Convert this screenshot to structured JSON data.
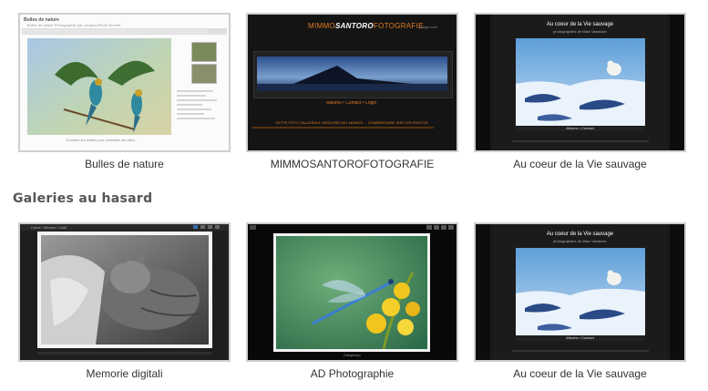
{
  "featured": [
    {
      "caption": "Bulles de nature",
      "site_title": "Bulles de nature",
      "site_subtitle": "Bulles de nature Photographie par Jacques-Pierre Bonnet",
      "photo_caption": "Ecoutez les bulles pour connaitre les ailes... "
    },
    {
      "caption": "MIMMOSANTOROFOTOGRAFIE",
      "logo_left": "MIMMO",
      "logo_mid": "SANTORO",
      "logo_right": "FOTOGRAFIE",
      "logo_tag": "piwigo.com",
      "menu": "Albums • Contact • Login",
      "footer": "CETTE FOTO GALLERIA IL MIGLIORE DEL MONDO ... COMMENTAIRE SUR LES PHOTOS"
    },
    {
      "caption": "Au coeur de la Vie sauvage",
      "site_title": "Au coeur de la Vie sauvage",
      "site_subtitle": "photographies de Marc Vanacker",
      "menu": "Albums • Contact"
    }
  ],
  "random_section": {
    "title": "Galeries au hasard",
    "items": [
      {
        "caption": "Memorie digitali",
        "breadcrumb": "Home / Albums / Gatti"
      },
      {
        "caption": "AD Photographie",
        "footer_text": "Calopteryx"
      },
      {
        "caption": "Au coeur de la Vie sauvage",
        "site_title": "Au coeur de la Vie sauvage",
        "site_subtitle": "photographies de Marc Vanacker",
        "menu": "Albums • Contact"
      }
    ]
  }
}
